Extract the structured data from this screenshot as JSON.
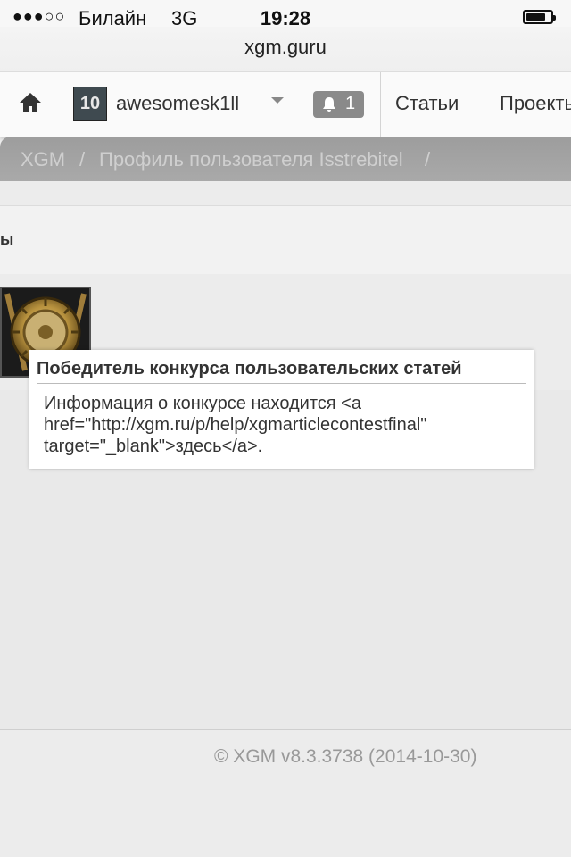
{
  "status_bar": {
    "signal": "●●●○○",
    "carrier": "Билайн",
    "network": "3G",
    "time": "19:28",
    "battery_level": 0.8
  },
  "browser": {
    "url": "xgm.guru"
  },
  "navbar": {
    "home_icon": "home-icon",
    "user_level": "10",
    "username": "awesomesk1ll",
    "notifications_count": "1",
    "links": [
      "Статьи",
      "Проекты"
    ]
  },
  "breadcrumb": {
    "root": "XGM",
    "separator": "/",
    "current": "Профиль пользователя Isstrebitel"
  },
  "section": {
    "header_fragment": "ы"
  },
  "tooltip": {
    "title": "Победитель конкурса пользовательских статей",
    "body": "Информация о конкурсе находится <a\nhref=\"http://xgm.ru/p/help/xgmarticlecontestfinal\"\ntarget=\"_blank\">здесь</a>."
  },
  "footer": {
    "text": "© XGM v8.3.3738 (2014-10-30)"
  },
  "colors": {
    "breadcrumb_bg": "#a3a3a3",
    "notif_bg": "#8a8a8a",
    "page_bg": "#ececec"
  }
}
